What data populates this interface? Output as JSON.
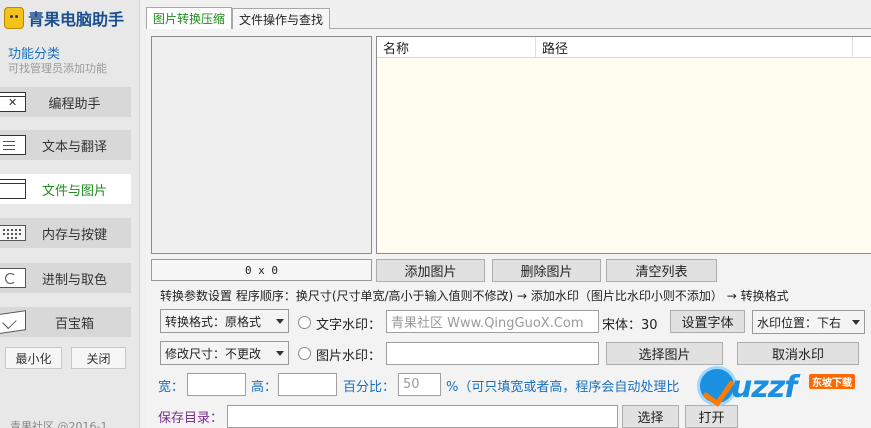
{
  "app": {
    "title": "青果电脑助手"
  },
  "sidebar": {
    "category_title": "功能分类",
    "category_sub": "可找管理员添加功能",
    "items": [
      {
        "label": "编程助手",
        "icon": "window-x-icon",
        "active": false
      },
      {
        "label": "文本与翻译",
        "icon": "document-icon",
        "active": false
      },
      {
        "label": "文件与图片",
        "icon": "window-icon",
        "active": true
      },
      {
        "label": "内存与按键",
        "icon": "keyboard-icon",
        "active": false
      },
      {
        "label": "进制与取色",
        "icon": "cycle-icon",
        "active": false
      },
      {
        "label": "百宝箱",
        "icon": "box-icon",
        "active": false
      }
    ],
    "minimize_label": "最小化",
    "close_label": "关闭",
    "footer": "青果社区 @2016-1"
  },
  "tabs": [
    {
      "label": "图片转换压缩",
      "active": true
    },
    {
      "label": "文件操作与查找",
      "active": false
    }
  ],
  "preview": {
    "dimensions": "0 x 0"
  },
  "file_list": {
    "columns": [
      "名称",
      "路径"
    ]
  },
  "list_buttons": {
    "add": "添加图片",
    "delete": "删除图片",
    "clear": "清空列表"
  },
  "params": {
    "title": "转换参数设置  程序顺序：换尺寸(尺寸单宽/高小于输入值则不修改) → 添加水印（图片比水印小则不添加） → 转换格式",
    "format_select": "转换格式：原格式",
    "resize_select": "修改尺寸：不更改",
    "text_wm_label": "文字水印：",
    "text_wm_placeholder": "青果社区 Www.QingGuoX.Com",
    "font_info": "宋体：30",
    "set_font": "设置字体",
    "wm_position": "水印位置：下右",
    "img_wm_label": "图片水印：",
    "img_wm_value": "",
    "choose_image": "选择图片",
    "cancel_wm": "取消水印",
    "width_label": "宽：",
    "width_value": "",
    "height_label": "高：",
    "height_value": "",
    "percent_label": "百分比：",
    "percent_value": "50",
    "percent_note": "%（可只填宽或者高，程序会自动处理比",
    "save_dir_label": "保存目录：",
    "save_dir_value": "",
    "choose_btn": "选择",
    "open_btn": "打开"
  },
  "watermark": {
    "text": "uzzf",
    "tag": "东坡下载"
  },
  "colors": {
    "active_green": "#1c8c1c",
    "label_blue": "#1a6fbf",
    "save_purple": "#7a2f8f",
    "list_bg": "#fffdf0"
  }
}
